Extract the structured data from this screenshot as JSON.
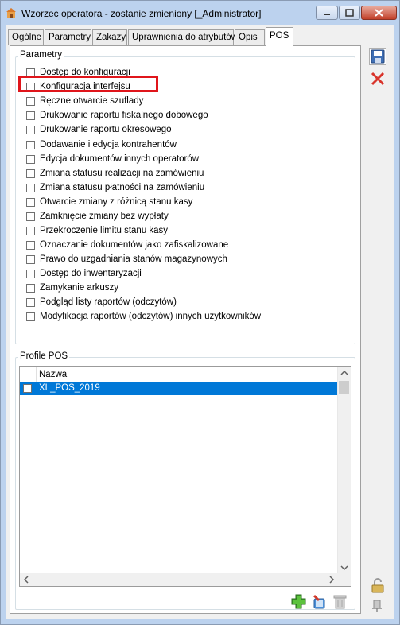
{
  "window": {
    "title": "Wzorzec operatora - zostanie zmieniony [_Administrator]"
  },
  "tabs": [
    {
      "label": "Ogólne"
    },
    {
      "label": "Parametry"
    },
    {
      "label": "Zakazy"
    },
    {
      "label": "Uprawnienia do atrybutów"
    },
    {
      "label": "Opis"
    },
    {
      "label": "POS"
    }
  ],
  "params": {
    "group_label": "Parametry",
    "items": [
      {
        "label": "Dostęp do konfiguracji",
        "checked": false
      },
      {
        "label": "Konfiguracja interfejsu",
        "checked": false
      },
      {
        "label": "Ręczne otwarcie szuflady",
        "checked": false
      },
      {
        "label": "Drukowanie raportu fiskalnego dobowego",
        "checked": false
      },
      {
        "label": "Drukowanie raportu okresowego",
        "checked": false
      },
      {
        "label": "Dodawanie i edycja kontrahentów",
        "checked": false
      },
      {
        "label": "Edycja dokumentów innych operatorów",
        "checked": false
      },
      {
        "label": "Zmiana statusu realizacji na zamówieniu",
        "checked": false
      },
      {
        "label": "Zmiana statusu płatności na zamówieniu",
        "checked": false
      },
      {
        "label": "Otwarcie zmiany z różnicą stanu kasy",
        "checked": false
      },
      {
        "label": "Zamknięcie zmiany bez wypłaty",
        "checked": false
      },
      {
        "label": "Przekroczenie limitu stanu kasy",
        "checked": false
      },
      {
        "label": "Oznaczanie dokumentów jako zafiskalizowane",
        "checked": false
      },
      {
        "label": "Prawo do uzgadniania stanów magazynowych",
        "checked": false
      },
      {
        "label": "Dostęp do inwentaryzacji",
        "checked": false
      },
      {
        "label": "Zamykanie arkuszy",
        "checked": false
      },
      {
        "label": "Podgląd listy raportów (odczytów)",
        "checked": false
      },
      {
        "label": "Modyfikacja raportów (odczytów) innych użytkowników",
        "checked": false
      }
    ]
  },
  "profiles": {
    "group_label": "Profile POS",
    "column_name": "Nazwa",
    "rows": [
      {
        "name": "XL_POS_2019",
        "checked": false,
        "selected": true
      }
    ]
  },
  "colors": {
    "accent": "#0078d7",
    "highlight": "#e0151b",
    "titlebar": "#bcd2ee"
  },
  "icons": {
    "save": "save-icon",
    "cancel": "cancel-icon",
    "add": "add-icon",
    "edit": "edit-icon",
    "delete": "trash-icon",
    "lock": "lock-icon",
    "pin": "pin-icon"
  }
}
